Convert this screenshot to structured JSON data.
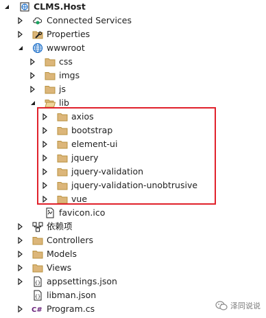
{
  "tree": {
    "project": "CLMS.Host",
    "connected_services": "Connected Services",
    "properties": "Properties",
    "wwwroot": "wwwroot",
    "css": "css",
    "imgs": "imgs",
    "js": "js",
    "lib": "lib",
    "lib_children": [
      "axios",
      "bootstrap",
      "element-ui",
      "jquery",
      "jquery-validation",
      "jquery-validation-unobtrusive",
      "vue"
    ],
    "favicon": "favicon.ico",
    "dependencies": "依赖项",
    "controllers": "Controllers",
    "models": "Models",
    "views": "Views",
    "appsettings": "appsettings.json",
    "libman": "libman.json",
    "program": "Program.cs"
  },
  "icons": {
    "folder": "folder-icon",
    "project": "csharp-project-icon",
    "globe": "globe-icon",
    "cloud": "connected-services-icon",
    "wrench": "properties-icon",
    "json": "json-file-icon",
    "csharp": "csharp-file-icon",
    "favicon": "favicon-file-icon",
    "deps": "dependencies-icon"
  },
  "colors": {
    "folder_fill": "#DCB67A",
    "folder_stroke": "#B8913F",
    "highlight_border": "#E0202A",
    "caret": "#1e1e1e",
    "csharp": "#68217A"
  },
  "watermark": {
    "text": "泽同说说"
  }
}
